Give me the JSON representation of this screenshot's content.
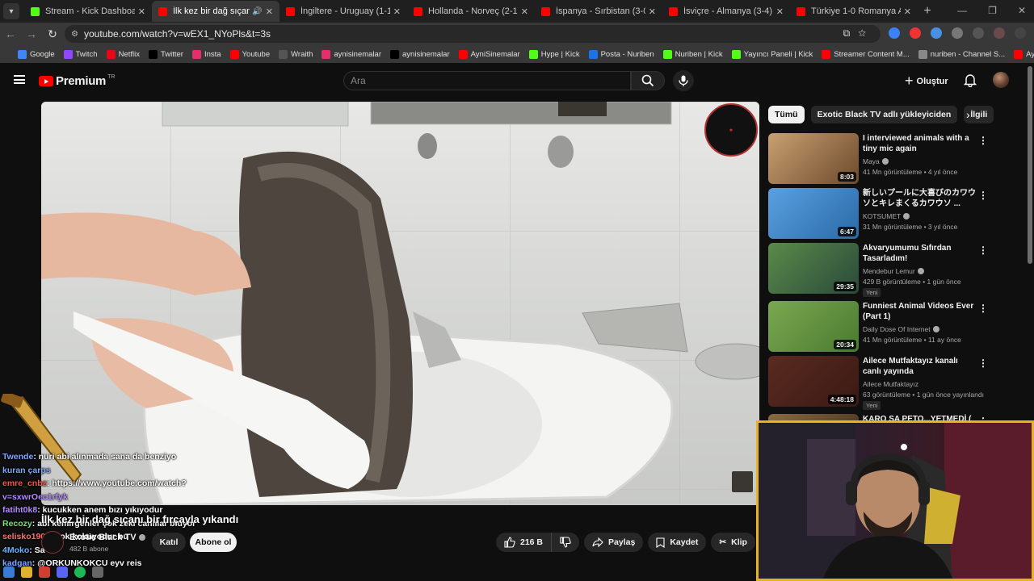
{
  "browser": {
    "tabs": [
      {
        "title": "Stream - Kick Dashboard",
        "icon_color": "#53fc18",
        "active": false
      },
      {
        "title": "İlk kez bir dağ sıçanı bir fırç",
        "icon_color": "#ff0000",
        "active": true,
        "audio": true
      },
      {
        "title": "İngiltere - Uruguay (1-1) Maç Ö",
        "icon_color": "#ff0000",
        "active": false
      },
      {
        "title": "Hollanda - Norveç (2-1) Maç Öze",
        "icon_color": "#ff0000",
        "active": false
      },
      {
        "title": "İspanya - Sırbistan (3-0) Maç Ö",
        "icon_color": "#ff0000",
        "active": false
      },
      {
        "title": "İsviçre - Almanya (3-4) Maç Öze",
        "icon_color": "#ff0000",
        "active": false
      },
      {
        "title": "Türkiye 1-0 Romanya Analizi - ",
        "icon_color": "#ff0000",
        "active": false
      }
    ],
    "url": "youtube.com/watch?v=wEX1_NYoPls&t=3s",
    "bookmarks": [
      {
        "label": "Google",
        "color": "#4285f4"
      },
      {
        "label": "Twitch",
        "color": "#9146ff"
      },
      {
        "label": "Netflix",
        "color": "#e50914"
      },
      {
        "label": "Twitter",
        "color": "#000000"
      },
      {
        "label": "Insta",
        "color": "#e1306c"
      },
      {
        "label": "Youtube",
        "color": "#ff0000"
      },
      {
        "label": "Wraith",
        "color": "#555555"
      },
      {
        "label": "aynisinemalar",
        "color": "#e1306c"
      },
      {
        "label": "aynisinemalar",
        "color": "#000000"
      },
      {
        "label": "AyniSinemalar",
        "color": "#ff0000"
      },
      {
        "label": "Hype | Kick",
        "color": "#53fc18"
      },
      {
        "label": "Posta - Nuriben",
        "color": "#1a73e8"
      },
      {
        "label": "Nuriben | Kick",
        "color": "#53fc18"
      },
      {
        "label": "Yayıncı Paneli | Kick",
        "color": "#53fc18"
      },
      {
        "label": "Streamer Content M...",
        "color": "#ff0000"
      },
      {
        "label": "nuriben - Channel S...",
        "color": "#888888"
      },
      {
        "label": "Aynı Sinemalar - Ça...",
        "color": "#ff0000"
      }
    ]
  },
  "youtube": {
    "logo_text": "Premium",
    "logo_country": "TR",
    "search_placeholder": "Ara",
    "create_label": "Oluştur"
  },
  "video": {
    "title": "İlk kez bir dağ sıçanı bir fırçayla yıkandı",
    "channel": "Exotic Black TV",
    "subscribers": "482 B abone",
    "join_label": "Katıl",
    "subscribe_label": "Abone ol",
    "likes": "216 B",
    "share_label": "Paylaş",
    "save_label": "Kaydet",
    "clip_label": "Klip"
  },
  "chat": [
    {
      "user": "Twende",
      "user_class": "u1",
      "text": "nuri abi alınmada sana da benziyo"
    },
    {
      "user": "",
      "user_class": "u1",
      "text": "kuran çarps"
    },
    {
      "user": "emre_cnbz",
      "user_class": "u2",
      "text": "https://www.youtube.com/watch?"
    },
    {
      "user": "",
      "user_class": "u3",
      "text": "v=sxwrOec1rfyk"
    },
    {
      "user": "fatiht0k8",
      "user_class": "u3",
      "text": "kucukken anem bızı yıkıyodur"
    },
    {
      "user": "Recozy",
      "user_class": "u4",
      "text": "abi kemirgenler çok zeki canlılar bluyor"
    },
    {
      "user": "selisko1903",
      "user_class": "u5",
      "text": "cok kokuyodur bu"
    },
    {
      "user": "4Moko",
      "user_class": "u6",
      "text": "Sa"
    },
    {
      "user": "kadgan",
      "user_class": "u1",
      "text": "@ORKUNKOKCU eyv reis"
    }
  ],
  "sidebar": {
    "chips": [
      "Tümü",
      "Exotic Black TV adlı yükleyiciden",
      "İlgili"
    ],
    "recommendations": [
      {
        "title": "I interviewed animals with a tiny mic again",
        "channel": "Maya",
        "verified": true,
        "meta": "41 Mn görüntüleme • 4 yıl önce",
        "duration": "8:03",
        "badge": "",
        "thumb_a": "#c8a070",
        "thumb_b": "#6e4a2e"
      },
      {
        "title": "新しいプールに大喜びのカワウソとキレまくるカワウソ ...",
        "channel": "KOTSUMET",
        "verified": true,
        "meta": "31 Mn görüntüleme • 3 yıl önce",
        "duration": "6:47",
        "badge": "",
        "thumb_a": "#5aa0e0",
        "thumb_b": "#2a6aa8"
      },
      {
        "title": "Akvaryumumu Sıfırdan Tasarladım!",
        "channel": "Mendebur Lemur",
        "verified": true,
        "meta": "429 B görüntüleme • 1 gün önce",
        "duration": "29:35",
        "badge": "Yeni",
        "thumb_a": "#5a8a4a",
        "thumb_b": "#2a4a3a"
      },
      {
        "title": "Funniest Animal Videos Ever (Part 1)",
        "channel": "Daily Dose Of Internet",
        "verified": true,
        "meta": "41 Mn görüntüleme • 11 ay önce",
        "duration": "20:34",
        "badge": "",
        "thumb_a": "#7aa850",
        "thumb_b": "#4a7a30"
      },
      {
        "title": "Ailece Mutfaktayız kanalı canlı yayında",
        "channel": "Ailece Mutfaktayız",
        "verified": false,
        "meta": "63 görüntüleme • 1 gün önce yayınlandı",
        "duration": "4:48:18",
        "badge": "Yeni",
        "thumb_a": "#5a2a20",
        "thumb_b": "#3a1a14"
      },
      {
        "title": "KARO SA PETO...YETMEDİ (",
        "channel": "",
        "verified": false,
        "meta": "",
        "duration": "",
        "badge": "",
        "thumb_a": "#8a6a40",
        "thumb_b": "#3a2a18"
      }
    ]
  },
  "colors": {
    "webcam_border": "#e6b422",
    "accent_red": "#ff0000"
  }
}
